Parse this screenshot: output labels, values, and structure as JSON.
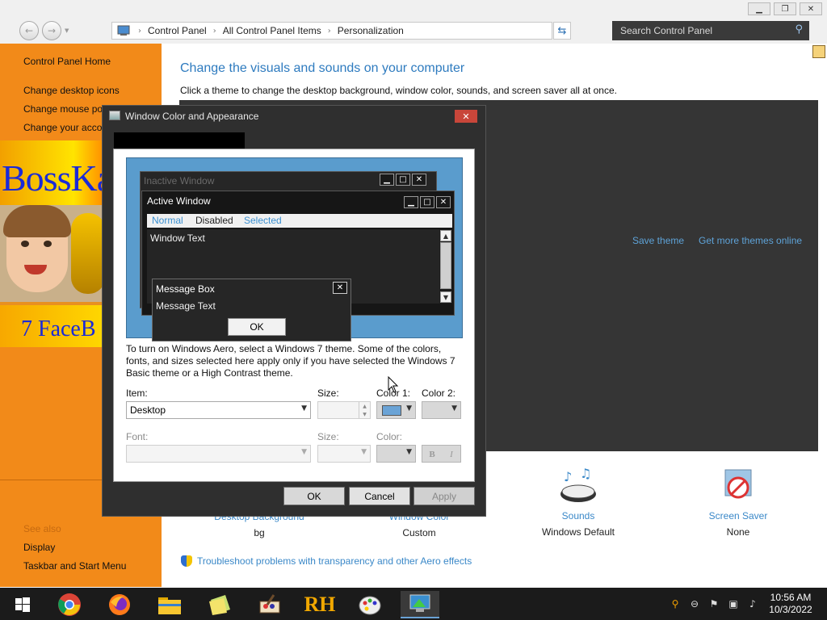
{
  "window": {
    "minimize_glyph": "▁",
    "restore_glyph": "❐",
    "close_glyph": "✕"
  },
  "address_bar": {
    "crumbs": [
      "Control Panel",
      "All Control Panel Items",
      "Personalization"
    ],
    "search_placeholder": "Search Control Panel"
  },
  "sidebar": {
    "home": "Control Panel Home",
    "links": [
      "Change desktop icons",
      "Change mouse po",
      "Change your acco"
    ],
    "banner_text": "BossKa",
    "banner_sub": "7 FaceB",
    "see_also_heading": "See also",
    "see_also": [
      "Display",
      "Taskbar and Start Menu"
    ]
  },
  "main": {
    "title": "Change the visuals and sounds on your computer",
    "subtitle": "Click a theme to change the desktop background, window color, sounds, and screen saver all at once.",
    "save_theme": "Save theme",
    "get_more": "Get more themes online",
    "bottom": [
      {
        "label": "Desktop Background",
        "value": "bg"
      },
      {
        "label": "Window Color",
        "value": "Custom"
      },
      {
        "label": "Sounds",
        "value": "Windows Default"
      },
      {
        "label": "Screen Saver",
        "value": "None"
      }
    ],
    "troubleshoot": "Troubleshoot problems with transparency and other Aero effects"
  },
  "dialog": {
    "title": "Window Color and Appearance",
    "preview": {
      "inactive_title": "Inactive Window",
      "active_title": "Active Window",
      "menu": [
        "Normal",
        "Disabled",
        "Selected"
      ],
      "window_text": "Window Text",
      "msg_title": "Message Box",
      "msg_text": "Message Text",
      "msg_ok": "OK"
    },
    "note": "To turn on Windows Aero, select a Windows 7 theme.  Some of the colors, fonts, and sizes selected here apply only if you have selected the Windows 7 Basic theme or a High Contrast theme.",
    "item_label": "Item:",
    "item_value": "Desktop",
    "size_label": "Size:",
    "color1_label": "Color 1:",
    "color2_label": "Color 2:",
    "font_label": "Font:",
    "font_size_label": "Size:",
    "font_color_label": "Color:",
    "bold": "B",
    "italic": "I",
    "ok": "OK",
    "cancel": "Cancel",
    "apply": "Apply"
  },
  "taskbar": {
    "time": "10:56 AM",
    "date": "10/3/2022",
    "rh_label": "RH"
  },
  "colors": {
    "sidebar": "#f28a19",
    "link": "#3a88c8",
    "dialog_frame": "#2f2f2f",
    "preview_bg": "#5a9ccd",
    "selected_menu": "#3a8fd0",
    "color1_swatch": "#6aa3d6"
  }
}
